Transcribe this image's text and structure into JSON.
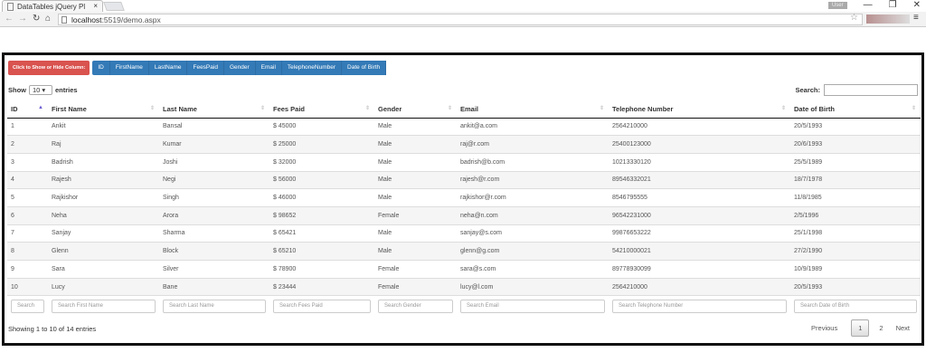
{
  "browser": {
    "tab_title": "DataTables jQuery Pl",
    "url_host": "localhost",
    "url_rest": ":5519/demo.aspx",
    "user_badge": "User"
  },
  "toggle": {
    "label": "Click to Show or Hide Column:",
    "columns": [
      "ID",
      "FirstName",
      "LastName",
      "FeesPaid",
      "Gender",
      "Email",
      "TelephoneNumber",
      "Date of Birth"
    ]
  },
  "length": {
    "show": "Show",
    "value": "10",
    "entries": "entries"
  },
  "search": {
    "label": "Search:",
    "value": ""
  },
  "table": {
    "headers": [
      "ID",
      "First Name",
      "Last Name",
      "Fees Paid",
      "Gender",
      "Email",
      "Telephone Number",
      "Date of Birth"
    ],
    "rows": [
      [
        "1",
        "Ankit",
        "Bansal",
        "$ 45000",
        "Male",
        "ankit@a.com",
        "2564210000",
        "20/5/1993"
      ],
      [
        "2",
        "Raj",
        "Kumar",
        "$ 25000",
        "Male",
        "raj@r.com",
        "25400123000",
        "20/6/1993"
      ],
      [
        "3",
        "Badrish",
        "Joshi",
        "$ 32000",
        "Male",
        "badrish@b.com",
        "10213330120",
        "25/5/1989"
      ],
      [
        "4",
        "Rajesh",
        "Negi",
        "$ 56000",
        "Male",
        "rajesh@r.com",
        "89546332021",
        "18/7/1978"
      ],
      [
        "5",
        "Rajkishor",
        "Singh",
        "$ 46000",
        "Male",
        "rajkishor@r.com",
        "8546795555",
        "11/8/1985"
      ],
      [
        "6",
        "Neha",
        "Arora",
        "$ 98652",
        "Female",
        "neha@n.com",
        "96542231000",
        "2/5/1996"
      ],
      [
        "7",
        "Sanjay",
        "Sharma",
        "$ 65421",
        "Male",
        "sanjay@s.com",
        "99876653222",
        "25/1/1998"
      ],
      [
        "8",
        "Glenn",
        "Block",
        "$ 65210",
        "Male",
        "glenn@g.com",
        "54210000021",
        "27/2/1990"
      ],
      [
        "9",
        "Sara",
        "Silver",
        "$ 78900",
        "Female",
        "sara@s.com",
        "89778930099",
        "10/9/1989"
      ],
      [
        "10",
        "Lucy",
        "Bane",
        "$ 23444",
        "Female",
        "lucy@l.com",
        "2564210000",
        "20/5/1993"
      ]
    ],
    "filters": [
      "Search",
      "Search First Name",
      "Search Last Name",
      "Search Fees Paid",
      "Search Gender",
      "Search Email",
      "Search Telephone Number",
      "Search Date of Birth"
    ]
  },
  "info": "Showing 1 to 10 of 14 entries",
  "pagination": {
    "previous": "Previous",
    "pages": [
      "1",
      "2"
    ],
    "next": "Next"
  }
}
